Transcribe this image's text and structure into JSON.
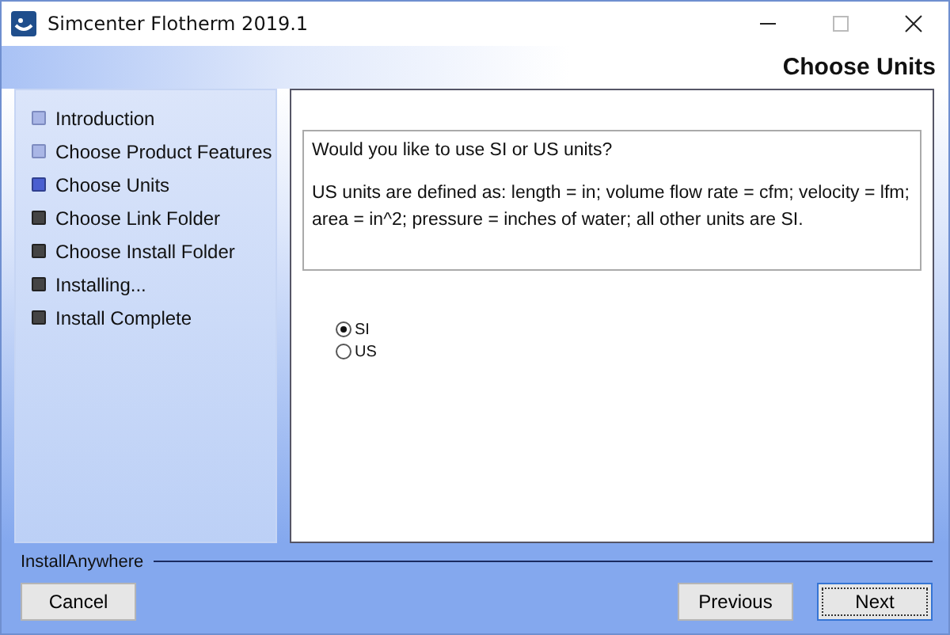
{
  "window": {
    "title": "Simcenter Flotherm 2019.1"
  },
  "header": {
    "title": "Choose Units"
  },
  "steps": [
    {
      "label": "Introduction",
      "completed": true,
      "selected": false
    },
    {
      "label": "Choose Product Features",
      "completed": true,
      "selected": false
    },
    {
      "label": "Choose Units",
      "completed": false,
      "selected": true
    },
    {
      "label": "Choose Link Folder",
      "completed": false,
      "selected": false
    },
    {
      "label": "Choose Install Folder",
      "completed": false,
      "selected": false
    },
    {
      "label": "Installing...",
      "completed": false,
      "selected": false
    },
    {
      "label": "Install Complete",
      "completed": false,
      "selected": false
    }
  ],
  "message": {
    "question": "Would you like to use SI or US units?",
    "details": "US units are defined as: length = in; volume flow rate = cfm; velocity = lfm; area = in^2; pressure = inches of water; all other units are SI."
  },
  "options": [
    {
      "label": "SI",
      "selected": true
    },
    {
      "label": "US",
      "selected": false
    }
  ],
  "footer": {
    "brand": "InstallAnywhere"
  },
  "buttons": {
    "cancel": "Cancel",
    "previous": "Previous",
    "next": "Next"
  }
}
